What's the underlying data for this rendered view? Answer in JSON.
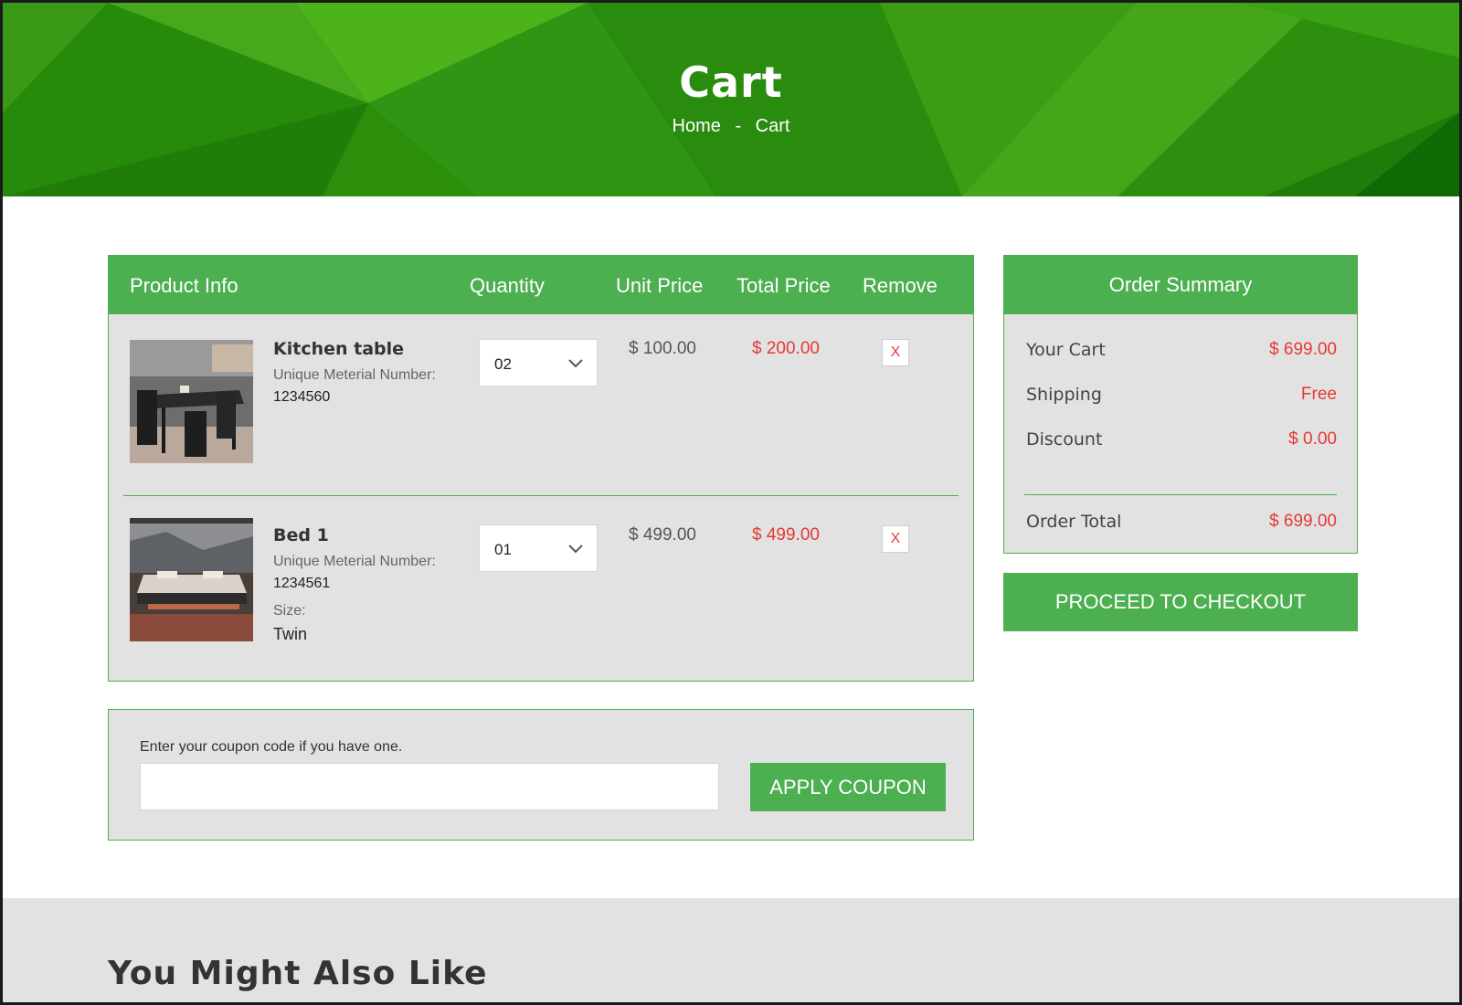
{
  "hero": {
    "title": "Cart",
    "breadcrumb": {
      "home": "Home",
      "separator": "-",
      "current": "Cart"
    }
  },
  "cart": {
    "headers": {
      "product_info": "Product Info",
      "quantity": "Quantity",
      "unit_price": "Unit Price",
      "total_price": "Total Price",
      "remove": "Remove"
    },
    "items": [
      {
        "name": "Kitchen table",
        "material_label": "Unique Meterial Number:",
        "material_number": "1234560",
        "quantity": "02",
        "unit_price": "$ 100.00",
        "total_price": "$ 200.00",
        "remove_label": "X",
        "image_icon": "kitchen-table-image"
      },
      {
        "name": "Bed 1",
        "material_label": "Unique Meterial Number:",
        "material_number": "1234561",
        "size_label": "Size:",
        "size_value": "Twin",
        "quantity": "01",
        "unit_price": "$ 499.00",
        "total_price": "$ 499.00",
        "remove_label": "X",
        "image_icon": "bed-image"
      }
    ]
  },
  "coupon": {
    "label": "Enter your coupon code if you have one.",
    "value": "",
    "button_label": "APPLY COUPON"
  },
  "summary": {
    "title": "Order Summary",
    "your_cart_label": "Your Cart",
    "your_cart_value": "$ 699.00",
    "shipping_label": "Shipping",
    "shipping_value": "Free",
    "discount_label": "Discount",
    "discount_value": "$ 0.00",
    "order_total_label": "Order Total",
    "order_total_value": "$ 699.00",
    "checkout_label": "PROCEED TO CHECKOUT"
  },
  "also_like": {
    "title": "You Might Also Like"
  },
  "colors": {
    "accent": "#4caf50",
    "hero_green": "#2b8f0c",
    "price_red": "#e53935",
    "panel_gray": "#e2e2e2"
  }
}
